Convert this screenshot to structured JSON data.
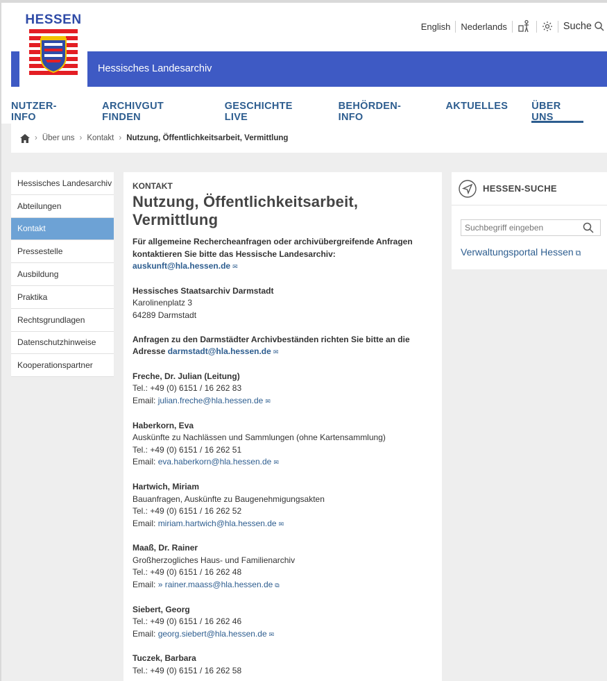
{
  "header": {
    "logo_text": "HESSEN",
    "archive_name": "Hessisches Landesarchiv",
    "lang_en": "English",
    "lang_nl": "Nederlands",
    "search_label": "Suche"
  },
  "nav": {
    "items": [
      "NUTZER-INFO",
      "ARCHIVGUT FINDEN",
      "GESCHICHTE LIVE",
      "BEHÖRDEN-INFO",
      "AKTUELLES",
      "ÜBER UNS"
    ],
    "active": "ÜBER UNS"
  },
  "breadcrumb": {
    "items": [
      "Über uns",
      "Kontakt"
    ],
    "current": "Nutzung, Öffentlichkeitsarbeit, Vermittlung"
  },
  "sidebar": {
    "items": [
      "Hessisches Landesarchiv",
      "Abteilungen",
      "Kontakt",
      "Pressestelle",
      "Ausbildung",
      "Praktika",
      "Rechtsgrundlagen",
      "Datenschutzhinweise",
      "Kooperationspartner"
    ],
    "active": "Kontakt"
  },
  "content": {
    "kicker": "KONTAKT",
    "title": "Nutzung, Öffentlichkeitsarbeit, Vermittlung",
    "intro": "Für allgemeine Rechercheanfragen oder archivübergreifende Anfragen kontaktieren Sie bitte das Hessische Landesarchiv:",
    "intro_email": "auskunft@hla.hessen.de",
    "address_name": "Hessisches Staatsarchiv Darmstadt",
    "address_street": "Karolinenplatz 3",
    "address_city": "64289 Darmstadt",
    "requests_text": "Anfragen zu den Darmstädter Archivbeständen richten Sie bitte an die Adresse",
    "requests_email": "darmstadt@hla.hessen.de",
    "contacts": [
      {
        "name": "Freche, Dr. Julian (Leitung)",
        "desc": "",
        "tel": "Tel.: +49 (0) 6151 / 16 262 83",
        "email": "julian.freche@hla.hessen.de"
      },
      {
        "name": "Haberkorn, Eva",
        "desc": "Auskünfte zu Nachlässen und Sammlungen (ohne Kartensammlung)",
        "tel": "Tel.: +49 (0) 6151 / 16 262 51",
        "email": "eva.haberkorn@hla.hessen.de"
      },
      {
        "name": "Hartwich, Miriam",
        "desc": "Bauanfragen, Auskünfte zu Baugenehmigungsakten",
        "tel": "Tel.: +49 (0) 6151 / 16 262 52",
        "email": "miriam.hartwich@hla.hessen.de"
      },
      {
        "name": "Maaß, Dr. Rainer",
        "desc": "Großherzogliches Haus- und Familienarchiv",
        "tel": "Tel.: +49 (0) 6151 / 16 262 48",
        "email": "» rainer.maass@hla.hessen.de"
      },
      {
        "name": "Siebert, Georg",
        "desc": "",
        "tel": "Tel.: +49 (0) 6151 / 16 262 46",
        "email": "georg.siebert@hla.hessen.de"
      },
      {
        "name": "Tuczek, Barbara",
        "desc": "",
        "tel": "Tel.: +49 (0) 6151 / 16 262 58",
        "email": ""
      }
    ],
    "email_label": "Email:"
  },
  "right_box": {
    "title": "HESSEN-SUCHE",
    "search_placeholder": "Suchbegriff eingeben",
    "link": "Verwaltungsportal Hessen"
  },
  "colors": {
    "brand_blue": "#3e5ac4",
    "nav_blue": "#2d5d8f",
    "sidebar_active": "#6da2d5"
  }
}
